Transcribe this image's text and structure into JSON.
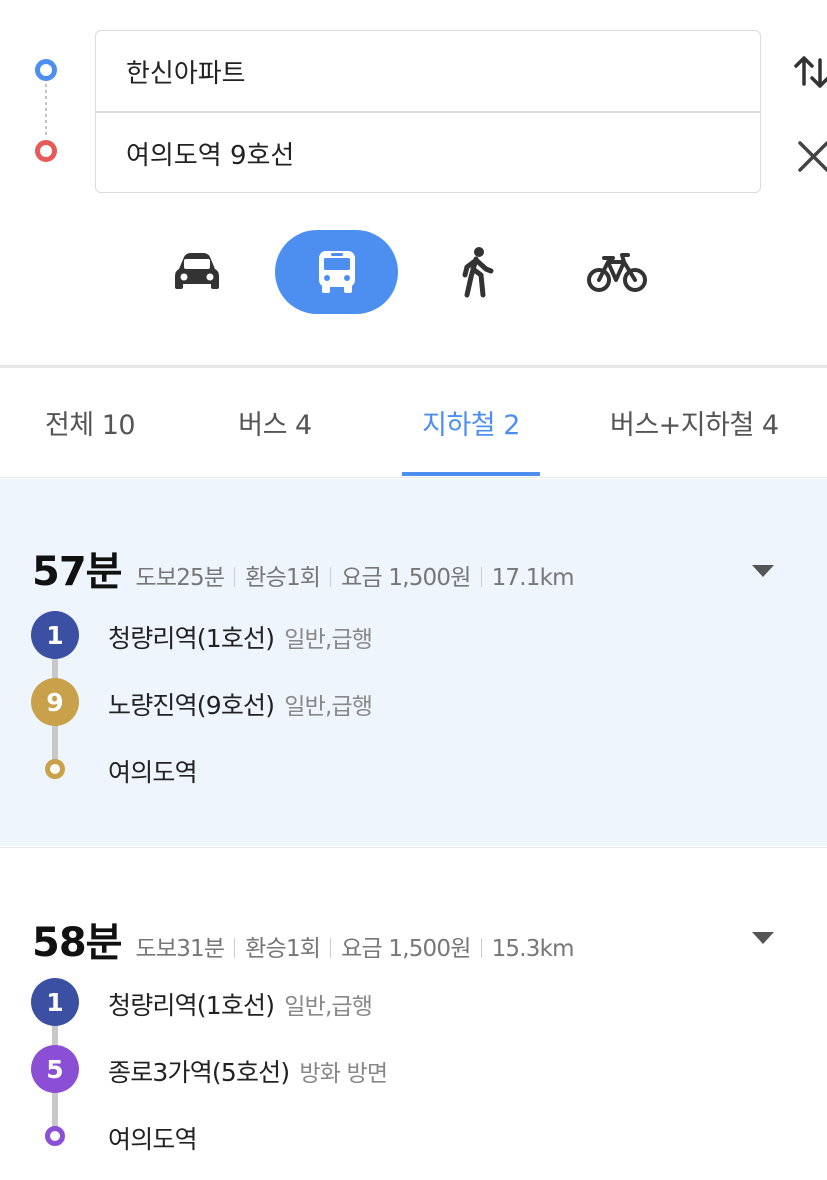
{
  "search": {
    "origin_value": "한신아파트",
    "destination_value": "여의도역 9호선",
    "swap_icon": "swap-vertical-icon",
    "clear_icon": "close-icon"
  },
  "modes": [
    {
      "name": "car",
      "icon": "car-icon",
      "selected": false
    },
    {
      "name": "transit",
      "icon": "bus-icon",
      "selected": true
    },
    {
      "name": "walk",
      "icon": "walk-icon",
      "selected": false
    },
    {
      "name": "bike",
      "icon": "bike-icon",
      "selected": false
    }
  ],
  "tabs": [
    {
      "label": "전체 10",
      "selected": false
    },
    {
      "label": "버스 4",
      "selected": false
    },
    {
      "label": "지하철 2",
      "selected": true
    },
    {
      "label": "버스+지하철 4",
      "selected": false
    }
  ],
  "routes": [
    {
      "duration": "57분",
      "walk": "도보25분",
      "transfers": "환승1회",
      "fare": "요금 1,500원",
      "distance": "17.1km",
      "steps": [
        {
          "badge": "1",
          "color": "#3b4fa3",
          "station": "청량리역(1호선)",
          "detail": "일반,급행"
        },
        {
          "badge": "9",
          "color": "#c9a14a",
          "station": "노량진역(9호선)",
          "detail": "일반,급행"
        },
        {
          "badge": "",
          "color": "#c9a14a",
          "station": "여의도역",
          "detail": ""
        }
      ]
    },
    {
      "duration": "58분",
      "walk": "도보31분",
      "transfers": "환승1회",
      "fare": "요금 1,500원",
      "distance": "15.3km",
      "steps": [
        {
          "badge": "1",
          "color": "#3b4fa3",
          "station": "청량리역(1호선)",
          "detail": "일반,급행"
        },
        {
          "badge": "5",
          "color": "#8b4fd6",
          "station": "종로3가역(5호선)",
          "detail": "방화 방면"
        },
        {
          "badge": "",
          "color": "#8b4fd6",
          "station": "여의도역",
          "detail": ""
        }
      ]
    }
  ],
  "colors": {
    "accent": "#4d8ff0",
    "origin_dot": "#4d8ff0",
    "destination_dot": "#e65a5a",
    "selected_route_bg": "#eef5fd",
    "line1": "#3b4fa3",
    "line9": "#c9a14a",
    "line5": "#8b4fd6"
  }
}
